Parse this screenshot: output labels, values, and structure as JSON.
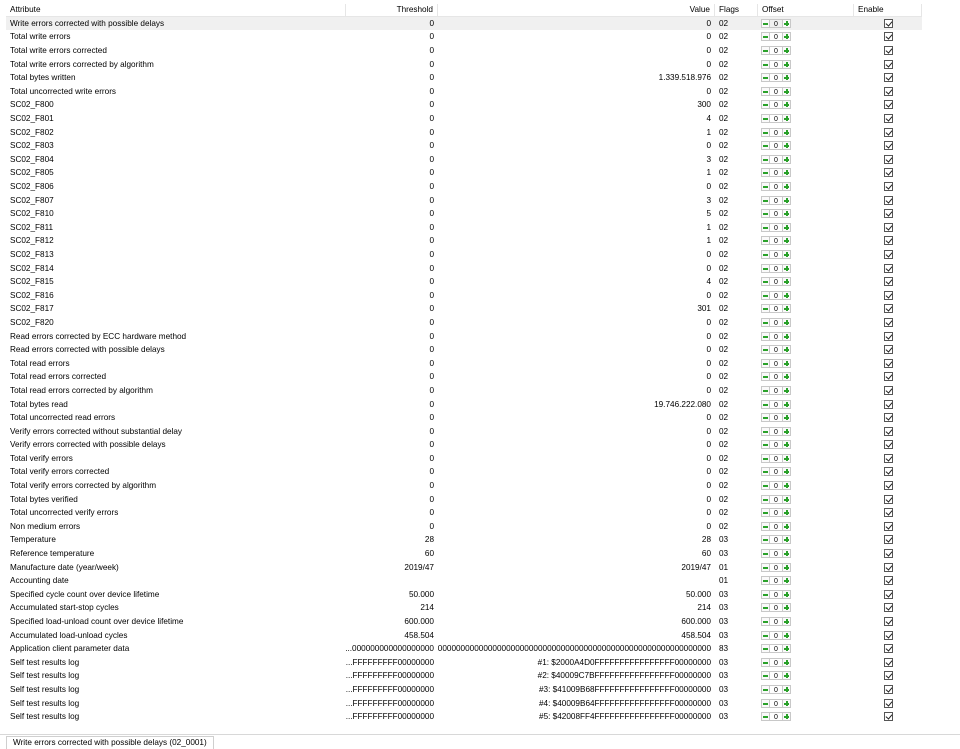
{
  "columns": {
    "attribute": "Attribute",
    "threshold": "Threshold",
    "value": "Value",
    "flags": "Flags",
    "offset": "Offset",
    "enable": "Enable"
  },
  "rows": [
    {
      "attribute": "Write errors corrected with possible delays",
      "threshold": "0",
      "value": "0",
      "flags": "02",
      "offset": "0"
    },
    {
      "attribute": "Total write errors",
      "threshold": "0",
      "value": "0",
      "flags": "02",
      "offset": "0"
    },
    {
      "attribute": "Total write errors corrected",
      "threshold": "0",
      "value": "0",
      "flags": "02",
      "offset": "0"
    },
    {
      "attribute": "Total write errors corrected by algorithm",
      "threshold": "0",
      "value": "0",
      "flags": "02",
      "offset": "0"
    },
    {
      "attribute": "Total bytes written",
      "threshold": "0",
      "value": "1.339.518.976",
      "flags": "02",
      "offset": "0"
    },
    {
      "attribute": "Total uncorrected write errors",
      "threshold": "0",
      "value": "0",
      "flags": "02",
      "offset": "0"
    },
    {
      "attribute": "SC02_F800",
      "threshold": "0",
      "value": "300",
      "flags": "02",
      "offset": "0"
    },
    {
      "attribute": "SC02_F801",
      "threshold": "0",
      "value": "4",
      "flags": "02",
      "offset": "0"
    },
    {
      "attribute": "SC02_F802",
      "threshold": "0",
      "value": "1",
      "flags": "02",
      "offset": "0"
    },
    {
      "attribute": "SC02_F803",
      "threshold": "0",
      "value": "0",
      "flags": "02",
      "offset": "0"
    },
    {
      "attribute": "SC02_F804",
      "threshold": "0",
      "value": "3",
      "flags": "02",
      "offset": "0"
    },
    {
      "attribute": "SC02_F805",
      "threshold": "0",
      "value": "1",
      "flags": "02",
      "offset": "0"
    },
    {
      "attribute": "SC02_F806",
      "threshold": "0",
      "value": "0",
      "flags": "02",
      "offset": "0"
    },
    {
      "attribute": "SC02_F807",
      "threshold": "0",
      "value": "3",
      "flags": "02",
      "offset": "0"
    },
    {
      "attribute": "SC02_F810",
      "threshold": "0",
      "value": "5",
      "flags": "02",
      "offset": "0"
    },
    {
      "attribute": "SC02_F811",
      "threshold": "0",
      "value": "1",
      "flags": "02",
      "offset": "0"
    },
    {
      "attribute": "SC02_F812",
      "threshold": "0",
      "value": "1",
      "flags": "02",
      "offset": "0"
    },
    {
      "attribute": "SC02_F813",
      "threshold": "0",
      "value": "0",
      "flags": "02",
      "offset": "0"
    },
    {
      "attribute": "SC02_F814",
      "threshold": "0",
      "value": "0",
      "flags": "02",
      "offset": "0"
    },
    {
      "attribute": "SC02_F815",
      "threshold": "0",
      "value": "4",
      "flags": "02",
      "offset": "0"
    },
    {
      "attribute": "SC02_F816",
      "threshold": "0",
      "value": "0",
      "flags": "02",
      "offset": "0"
    },
    {
      "attribute": "SC02_F817",
      "threshold": "0",
      "value": "301",
      "flags": "02",
      "offset": "0"
    },
    {
      "attribute": "SC02_F820",
      "threshold": "0",
      "value": "0",
      "flags": "02",
      "offset": "0"
    },
    {
      "attribute": "Read errors corrected by ECC hardware method",
      "threshold": "0",
      "value": "0",
      "flags": "02",
      "offset": "0"
    },
    {
      "attribute": "Read errors corrected with possible delays",
      "threshold": "0",
      "value": "0",
      "flags": "02",
      "offset": "0"
    },
    {
      "attribute": "Total read errors",
      "threshold": "0",
      "value": "0",
      "flags": "02",
      "offset": "0"
    },
    {
      "attribute": "Total read errors corrected",
      "threshold": "0",
      "value": "0",
      "flags": "02",
      "offset": "0"
    },
    {
      "attribute": "Total read errors corrected by algorithm",
      "threshold": "0",
      "value": "0",
      "flags": "02",
      "offset": "0"
    },
    {
      "attribute": "Total bytes read",
      "threshold": "0",
      "value": "19.746.222.080",
      "flags": "02",
      "offset": "0"
    },
    {
      "attribute": "Total uncorrected read errors",
      "threshold": "0",
      "value": "0",
      "flags": "02",
      "offset": "0"
    },
    {
      "attribute": "Verify errors corrected without substantial delay",
      "threshold": "0",
      "value": "0",
      "flags": "02",
      "offset": "0"
    },
    {
      "attribute": "Verify errors corrected with possible delays",
      "threshold": "0",
      "value": "0",
      "flags": "02",
      "offset": "0"
    },
    {
      "attribute": "Total verify errors",
      "threshold": "0",
      "value": "0",
      "flags": "02",
      "offset": "0"
    },
    {
      "attribute": "Total verify errors corrected",
      "threshold": "0",
      "value": "0",
      "flags": "02",
      "offset": "0"
    },
    {
      "attribute": "Total verify errors corrected by algorithm",
      "threshold": "0",
      "value": "0",
      "flags": "02",
      "offset": "0"
    },
    {
      "attribute": "Total bytes verified",
      "threshold": "0",
      "value": "0",
      "flags": "02",
      "offset": "0"
    },
    {
      "attribute": "Total uncorrected verify errors",
      "threshold": "0",
      "value": "0",
      "flags": "02",
      "offset": "0"
    },
    {
      "attribute": "Non medium errors",
      "threshold": "0",
      "value": "0",
      "flags": "02",
      "offset": "0"
    },
    {
      "attribute": "Temperature",
      "threshold": "28",
      "value": "28",
      "flags": "03",
      "offset": "0"
    },
    {
      "attribute": "Reference temperature",
      "threshold": "60",
      "value": "60",
      "flags": "03",
      "offset": "0"
    },
    {
      "attribute": "Manufacture date (year/week)",
      "threshold": "2019/47",
      "value": "2019/47",
      "flags": "01",
      "offset": "0"
    },
    {
      "attribute": "Accounting date",
      "threshold": "",
      "value": "",
      "flags": "01",
      "offset": "0"
    },
    {
      "attribute": "Specified cycle count over device lifetime",
      "threshold": "50.000",
      "value": "50.000",
      "flags": "03",
      "offset": "0"
    },
    {
      "attribute": "Accumulated start-stop cycles",
      "threshold": "214",
      "value": "214",
      "flags": "03",
      "offset": "0"
    },
    {
      "attribute": "Specified load-unload count over device lifetime",
      "threshold": "600.000",
      "value": "600.000",
      "flags": "03",
      "offset": "0"
    },
    {
      "attribute": "Accumulated load-unload cycles",
      "threshold": "458.504",
      "value": "458.504",
      "flags": "03",
      "offset": "0"
    },
    {
      "attribute": "Application client parameter data",
      "threshold": "...000000000000000000",
      "value": "...0000000000000000000000000000000000000000000000000000000000000000",
      "flags": "83",
      "offset": "0"
    },
    {
      "attribute": "Self test results log",
      "threshold": "...FFFFFFFFF00000000",
      "value": "#1: $2000A4D0FFFFFFFFFFFFFFFF00000000",
      "flags": "03",
      "offset": "0"
    },
    {
      "attribute": "Self test results log",
      "threshold": "...FFFFFFFFF00000000",
      "value": "#2: $40009C7BFFFFFFFFFFFFFFFF00000000",
      "flags": "03",
      "offset": "0"
    },
    {
      "attribute": "Self test results log",
      "threshold": "...FFFFFFFFF00000000",
      "value": "#3: $41009B68FFFFFFFFFFFFFFFF00000000",
      "flags": "03",
      "offset": "0"
    },
    {
      "attribute": "Self test results log",
      "threshold": "...FFFFFFFFF00000000",
      "value": "#4: $40009B64FFFFFFFFFFFFFFFF00000000",
      "flags": "03",
      "offset": "0"
    },
    {
      "attribute": "Self test results log",
      "threshold": "...FFFFFFFFF00000000",
      "value": "#5: $42008FF4FFFFFFFFFFFFFFFF00000000",
      "flags": "03",
      "offset": "0"
    }
  ],
  "status_tab": "Write errors corrected with possible delays (02_0001)"
}
